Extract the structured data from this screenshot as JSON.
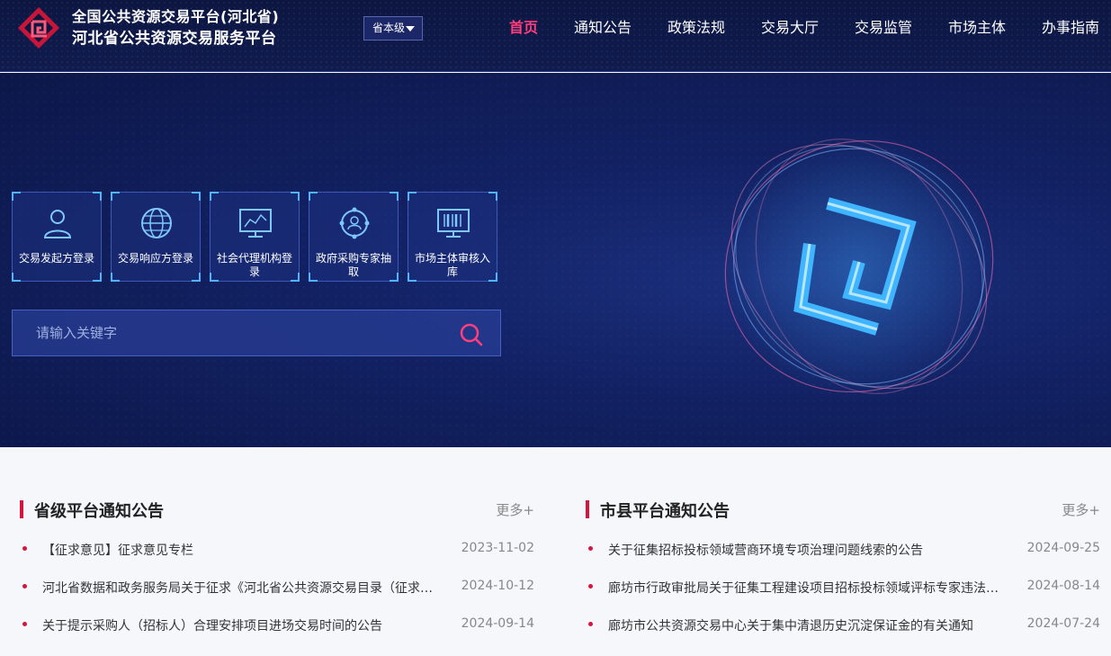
{
  "header": {
    "title_line1": "全国公共资源交易平台(河北省)",
    "title_line2": "河北省公共资源交易服务平台",
    "level_select": "省本级",
    "nav": [
      {
        "label": "首页",
        "active": true
      },
      {
        "label": "通知公告"
      },
      {
        "label": "政策法规"
      },
      {
        "label": "交易大厅"
      },
      {
        "label": "交易监管"
      },
      {
        "label": "市场主体"
      },
      {
        "label": "办事指南"
      }
    ]
  },
  "hero": {
    "tiles": [
      {
        "label": "交易发起方登录",
        "icon": "user-icon"
      },
      {
        "label": "交易响应方登录",
        "icon": "globe-icon"
      },
      {
        "label": "社会代理机构登录",
        "icon": "monitor-chart-icon"
      },
      {
        "label": "政府采购专家抽取",
        "icon": "expert-network-icon"
      },
      {
        "label": "市场主体审核入库",
        "icon": "barcode-screen-icon"
      }
    ],
    "search_placeholder": "请输入关键字"
  },
  "notices": {
    "provincial": {
      "title": "省级平台通知公告",
      "more": "更多+",
      "items": [
        {
          "title": "【征求意见】征求意见专栏",
          "date": "2023-11-02"
        },
        {
          "title": "河北省数据和政务服务局关于征求《河北省公共资源交易目录（征求…",
          "date": "2024-10-12"
        },
        {
          "title": "关于提示采购人（招标人）合理安排项目进场交易时间的公告",
          "date": "2024-09-14"
        }
      ]
    },
    "city": {
      "title": "市县平台通知公告",
      "more": "更多+",
      "items": [
        {
          "title": "关于征集招标投标领域营商环境专项治理问题线索的公告",
          "date": "2024-09-25"
        },
        {
          "title": "廊坊市行政审批局关于征集工程建设项目招标投标领域评标专家违法…",
          "date": "2024-08-14"
        },
        {
          "title": "廊坊市公共资源交易中心关于集中清退历史沉淀保证金的有关通知",
          "date": "2024-07-24"
        }
      ]
    }
  },
  "colors": {
    "accent": "#ff3e7c",
    "brand_red": "#d6153d",
    "header_bg": "#0d1640",
    "hero_bg": "#122163"
  }
}
